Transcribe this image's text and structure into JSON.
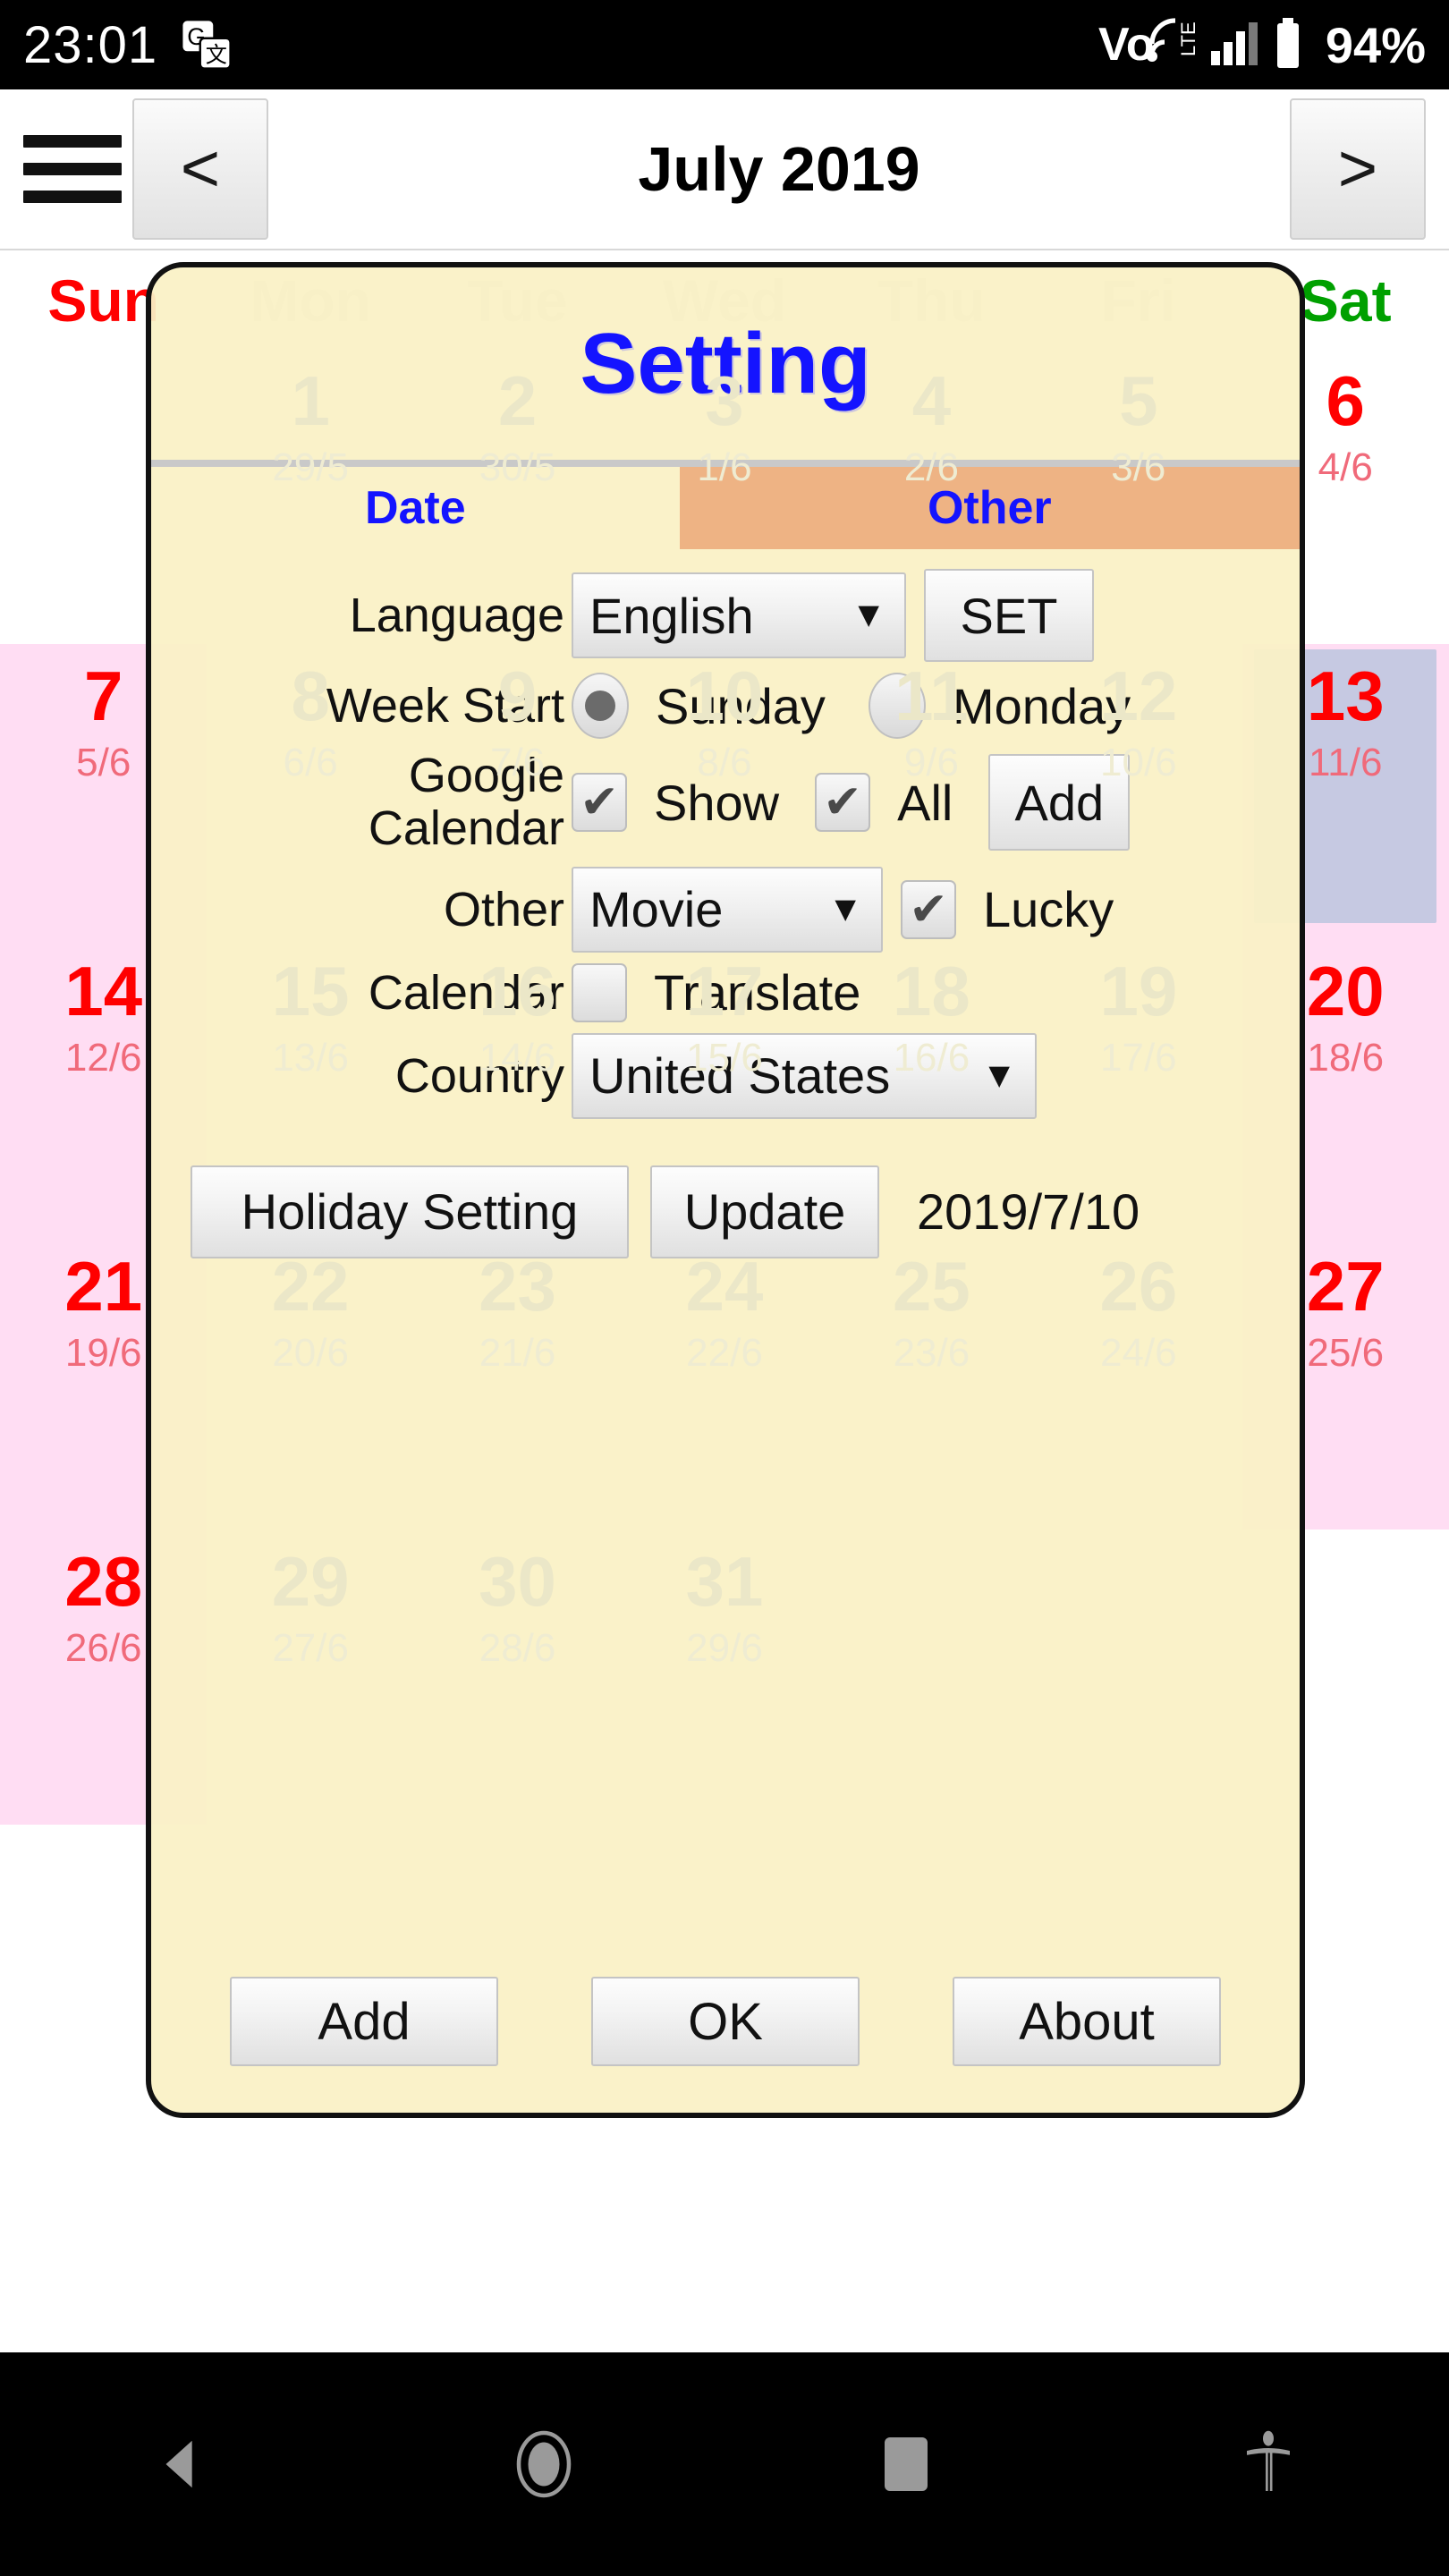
{
  "status_bar": {
    "time": "23:01",
    "translate_icon": "google-translate-icon",
    "network_label": "VoLTE",
    "signal_icon": "signal-bars-icon",
    "battery_icon": "battery-icon",
    "battery_percent": "94%"
  },
  "app_bar": {
    "menu_icon": "hamburger-menu-icon",
    "prev_label": "<",
    "title": "July 2019",
    "next_label": ">"
  },
  "calendar": {
    "weekdays": [
      "Sun",
      "Mon",
      "Tue",
      "Wed",
      "Thu",
      "Fri",
      "Sat"
    ],
    "weekend_color": "#ff0000",
    "saturday_header_color": "#00a000",
    "selected_day": "13",
    "selected_bg": "#c6c9e2",
    "weekend_row_bg": "#ffddf3",
    "rows": [
      [
        {
          "day": "",
          "lunar": ""
        },
        {
          "day": "1",
          "lunar": "29/5"
        },
        {
          "day": "2",
          "lunar": "30/5"
        },
        {
          "day": "3",
          "lunar": "1/6"
        },
        {
          "day": "4",
          "lunar": "2/6"
        },
        {
          "day": "5",
          "lunar": "3/6"
        },
        {
          "day": "6",
          "lunar": "4/6"
        }
      ],
      [
        {
          "day": "7",
          "lunar": "5/6"
        },
        {
          "day": "8",
          "lunar": "6/6"
        },
        {
          "day": "9",
          "lunar": "7/6"
        },
        {
          "day": "10",
          "lunar": "8/6"
        },
        {
          "day": "11",
          "lunar": "9/6"
        },
        {
          "day": "12",
          "lunar": "10/6"
        },
        {
          "day": "13",
          "lunar": "11/6"
        }
      ],
      [
        {
          "day": "14",
          "lunar": "12/6"
        },
        {
          "day": "15",
          "lunar": "13/6"
        },
        {
          "day": "16",
          "lunar": "14/6"
        },
        {
          "day": "17",
          "lunar": "15/6"
        },
        {
          "day": "18",
          "lunar": "16/6"
        },
        {
          "day": "19",
          "lunar": "17/6"
        },
        {
          "day": "20",
          "lunar": "18/6"
        }
      ],
      [
        {
          "day": "21",
          "lunar": "19/6"
        },
        {
          "day": "22",
          "lunar": "20/6"
        },
        {
          "day": "23",
          "lunar": "21/6"
        },
        {
          "day": "24",
          "lunar": "22/6"
        },
        {
          "day": "25",
          "lunar": "23/6"
        },
        {
          "day": "26",
          "lunar": "24/6"
        },
        {
          "day": "27",
          "lunar": "25/6"
        }
      ],
      [
        {
          "day": "28",
          "lunar": "26/6"
        },
        {
          "day": "29",
          "lunar": "27/6"
        },
        {
          "day": "30",
          "lunar": "28/6"
        },
        {
          "day": "31",
          "lunar": "29/6"
        },
        {
          "day": "",
          "lunar": ""
        },
        {
          "day": "",
          "lunar": ""
        },
        {
          "day": "",
          "lunar": ""
        }
      ]
    ]
  },
  "dialog": {
    "title": "Setting",
    "title_color": "#1414ff",
    "tabs": [
      {
        "label": "Date",
        "selected": false
      },
      {
        "label": "Other",
        "selected": true
      }
    ],
    "tab_selected_bg": "#eeb384",
    "language": {
      "label": "Language",
      "value": "English",
      "caret": "▼",
      "set_button": "SET"
    },
    "week_start": {
      "label": "Week Start",
      "options": [
        {
          "label": "Sunday",
          "selected": true
        },
        {
          "label": "Monday",
          "selected": false
        }
      ]
    },
    "google_calendar": {
      "label_line1": "Google",
      "label_line2": "Calendar",
      "show": {
        "label": "Show",
        "checked": true
      },
      "all": {
        "label": "All",
        "checked": true
      },
      "add_button": "Add"
    },
    "other_calendar": {
      "label_line1": "Other",
      "label_line2": "Calendar",
      "value": "Movie",
      "caret": "▼",
      "lucky": {
        "label": "Lucky",
        "checked": true
      },
      "translate": {
        "label": "Translate",
        "checked": false
      }
    },
    "country": {
      "label": "Country",
      "value": "United States",
      "caret": "▼"
    },
    "holiday_setting_button": "Holiday Setting",
    "update_button": "Update",
    "update_date": "2019/7/10",
    "footer_buttons": [
      {
        "label": "Add"
      },
      {
        "label": "OK"
      },
      {
        "label": "About"
      }
    ],
    "checkmark": "✔"
  },
  "nav_bar": {
    "back_icon": "back-triangle-icon",
    "home_icon": "home-circle-icon",
    "recents_icon": "recents-square-icon",
    "accessibility_icon": "accessibility-icon"
  }
}
